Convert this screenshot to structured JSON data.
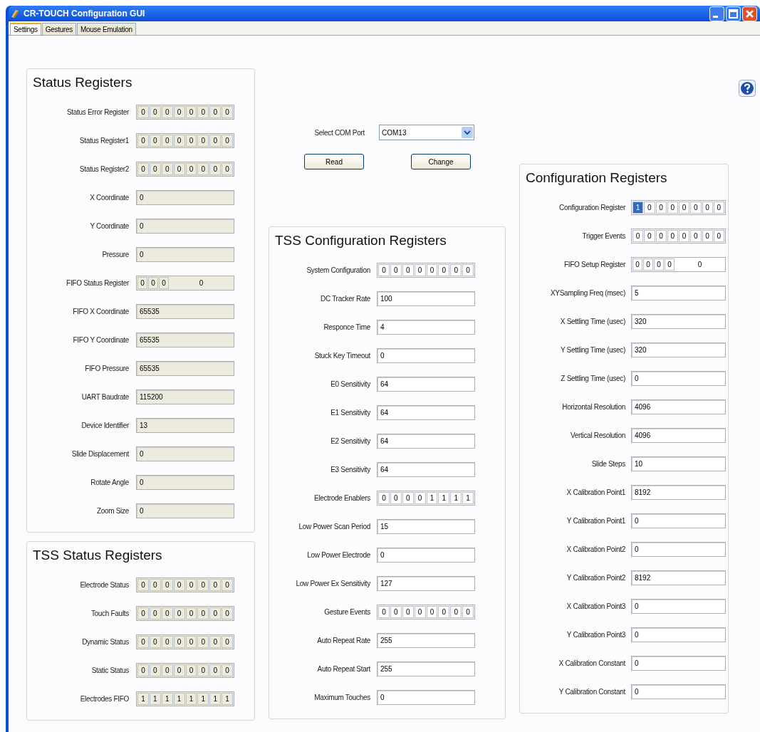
{
  "window": {
    "title": "CR-TOUCH Configuration GUI"
  },
  "tabs": [
    {
      "label": "Settings",
      "selected": true
    },
    {
      "label": "Gestures",
      "selected": false
    },
    {
      "label": "Mouse Emulation",
      "selected": false
    }
  ],
  "status_registers": {
    "title": "Status Registers",
    "readonly": true,
    "rows": [
      {
        "label": "Status Error Register",
        "kind": "bits",
        "bits": [
          "0",
          "0",
          "0",
          "0",
          "0",
          "0",
          "0",
          "0"
        ]
      },
      {
        "label": "Status Register1",
        "kind": "bits",
        "bits": [
          "0",
          "0",
          "0",
          "0",
          "0",
          "0",
          "0",
          "0"
        ]
      },
      {
        "label": "Status Register2",
        "kind": "bits",
        "bits": [
          "0",
          "0",
          "0",
          "0",
          "0",
          "0",
          "0",
          "0"
        ]
      },
      {
        "label": "X Coordinate",
        "kind": "text",
        "value": "0"
      },
      {
        "label": "Y Coordinate",
        "kind": "text",
        "value": "0"
      },
      {
        "label": "Pressure",
        "kind": "text",
        "value": "0"
      },
      {
        "label": "FIFO Status Register",
        "kind": "bits_value",
        "bits": [
          "0",
          "0",
          "0"
        ],
        "value": "0"
      },
      {
        "label": "FIFO X Coordinate",
        "kind": "text",
        "value": "65535"
      },
      {
        "label": "FIFO Y Coordinate",
        "kind": "text",
        "value": "65535"
      },
      {
        "label": "FIFO Pressure",
        "kind": "text",
        "value": "65535"
      },
      {
        "label": "UART Baudrate",
        "kind": "text",
        "value": "115200"
      },
      {
        "label": "Device Identifier",
        "kind": "text",
        "value": "13"
      },
      {
        "label": "Slide Displacement",
        "kind": "text",
        "value": "0"
      },
      {
        "label": "Rotate Angle",
        "kind": "text",
        "value": "0"
      },
      {
        "label": "Zoom Size",
        "kind": "text",
        "value": "0"
      }
    ]
  },
  "tss_status_registers": {
    "title": "TSS Status Registers",
    "readonly": true,
    "rows": [
      {
        "label": "Electrode Status",
        "kind": "bits",
        "bits": [
          "0",
          "0",
          "0",
          "0",
          "0",
          "0",
          "0",
          "0"
        ]
      },
      {
        "label": "Touch Faults",
        "kind": "bits",
        "bits": [
          "0",
          "0",
          "0",
          "0",
          "0",
          "0",
          "0",
          "0"
        ]
      },
      {
        "label": "Dynamic Status",
        "kind": "bits",
        "bits": [
          "0",
          "0",
          "0",
          "0",
          "0",
          "0",
          "0",
          "0"
        ]
      },
      {
        "label": "Static Status",
        "kind": "bits",
        "bits": [
          "0",
          "0",
          "0",
          "0",
          "0",
          "0",
          "0",
          "0"
        ]
      },
      {
        "label": "Electrodes FIFO",
        "kind": "bits",
        "bits": [
          "1",
          "1",
          "1",
          "1",
          "1",
          "1",
          "1",
          "1"
        ]
      }
    ]
  },
  "com_port": {
    "label": "Select COM Port",
    "value": "COM13"
  },
  "buttons": [
    "Read",
    "Change"
  ],
  "tss_configuration_registers": {
    "title": "TSS Configuration Registers",
    "readonly": false,
    "rows": [
      {
        "label": "System Configuration",
        "kind": "bits",
        "bits": [
          "0",
          "0",
          "0",
          "0",
          "0",
          "0",
          "0",
          "0"
        ]
      },
      {
        "label": "DC Tracker Rate",
        "kind": "text",
        "value": "100"
      },
      {
        "label": "Responce Time",
        "kind": "text",
        "value": "4"
      },
      {
        "label": "Stuck Key Timeout",
        "kind": "text",
        "value": "0"
      },
      {
        "label": "E0 Sensitivity",
        "kind": "text",
        "value": "64"
      },
      {
        "label": "E1 Sensitivity",
        "kind": "text",
        "value": "64"
      },
      {
        "label": "E2 Sensitivity",
        "kind": "text",
        "value": "64"
      },
      {
        "label": "E3 Sensitivity",
        "kind": "text",
        "value": "64"
      },
      {
        "label": "Electrode Enablers",
        "kind": "bits",
        "bits": [
          "0",
          "0",
          "0",
          "0",
          "1",
          "1",
          "1",
          "1"
        ]
      },
      {
        "label": "Low Power Scan Period",
        "kind": "text",
        "value": "15"
      },
      {
        "label": "Low Power Electrode",
        "kind": "text",
        "value": "0"
      },
      {
        "label": "Low Power Ex Sensitivity",
        "kind": "text",
        "value": "127"
      },
      {
        "label": "Gesture Events",
        "kind": "bits",
        "bits": [
          "0",
          "0",
          "0",
          "0",
          "0",
          "0",
          "0",
          "0"
        ]
      },
      {
        "label": "Auto Repeat Rate",
        "kind": "text",
        "value": "255"
      },
      {
        "label": "Auto Repeat Start",
        "kind": "text",
        "value": "255"
      },
      {
        "label": "Maximum Touches",
        "kind": "text",
        "value": "0"
      }
    ]
  },
  "configuration_registers": {
    "title": "Configuration Registers",
    "readonly": false,
    "rows": [
      {
        "label": "Configuration Register",
        "kind": "bits",
        "bits": [
          "1",
          "0",
          "0",
          "0",
          "0",
          "0",
          "0",
          "0"
        ],
        "first_bit_highlighted": true
      },
      {
        "label": "Trigger Events",
        "kind": "bits",
        "bits": [
          "0",
          "0",
          "0",
          "0",
          "0",
          "0",
          "0",
          "0"
        ]
      },
      {
        "label": "FIFO Setup Register",
        "kind": "bits_value",
        "bits": [
          "0",
          "0",
          "0",
          "0"
        ],
        "value": "0"
      },
      {
        "label": "XYSampling Freq (msec)",
        "kind": "text",
        "value": "5"
      },
      {
        "label": "X Settling Time (usec)",
        "kind": "text",
        "value": "320"
      },
      {
        "label": "Y Settling Time (usec)",
        "kind": "text",
        "value": "320"
      },
      {
        "label": "Z Settling Time (usec)",
        "kind": "text",
        "value": "0"
      },
      {
        "label": "Horizontal Resolution",
        "kind": "text",
        "value": "4096"
      },
      {
        "label": "Vertical Resolution",
        "kind": "text",
        "value": "4096"
      },
      {
        "label": "Slide Steps",
        "kind": "text",
        "value": "10"
      },
      {
        "label": "X Calibration Point1",
        "kind": "text",
        "value": "8192"
      },
      {
        "label": "Y Calibration Point1",
        "kind": "text",
        "value": "0"
      },
      {
        "label": "X Calibration Point2",
        "kind": "text",
        "value": "0"
      },
      {
        "label": "Y Calibration Point2",
        "kind": "text",
        "value": "8192"
      },
      {
        "label": "X Calibration Point3",
        "kind": "text",
        "value": "0"
      },
      {
        "label": "Y Calibration Point3",
        "kind": "text",
        "value": "0"
      },
      {
        "label": "X Calibration Constant",
        "kind": "text",
        "value": "0"
      },
      {
        "label": "Y Calibration Constant",
        "kind": "text",
        "value": "0"
      }
    ]
  }
}
